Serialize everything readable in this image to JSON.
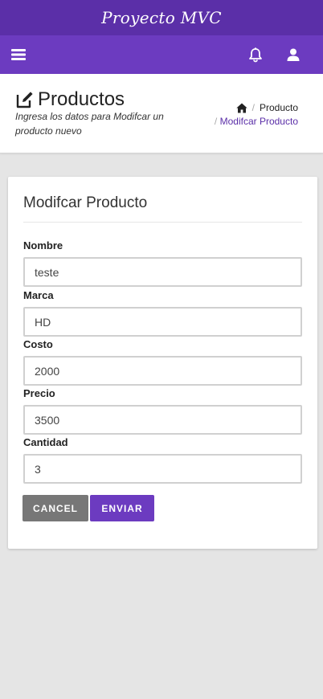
{
  "brand": {
    "title": "Proyecto MVC"
  },
  "navbar": {
    "icons": [
      "menu-icon",
      "bell-icon",
      "user-icon"
    ]
  },
  "header": {
    "title": "Productos",
    "subtitle": "Ingresa los datos para Modifcar un producto nuevo",
    "breadcrumb": {
      "home_icon": "home-icon",
      "item1": "Producto",
      "item2": "Modifcar Producto"
    }
  },
  "form": {
    "title": "Modifcar Producto",
    "fields": [
      {
        "label": "Nombre",
        "value": "teste"
      },
      {
        "label": "Marca",
        "value": "HD"
      },
      {
        "label": "Costo",
        "value": "2000"
      },
      {
        "label": "Precio",
        "value": "3500"
      },
      {
        "label": "Cantidad",
        "value": "3"
      }
    ],
    "cancel_label": "CANCEL",
    "submit_label": "ENVIAR"
  },
  "colors": {
    "brand_purple": "#5b2fa8",
    "nav_purple": "#6c3bc0",
    "cancel_gray": "#777777",
    "background": "#e5e5e5"
  }
}
